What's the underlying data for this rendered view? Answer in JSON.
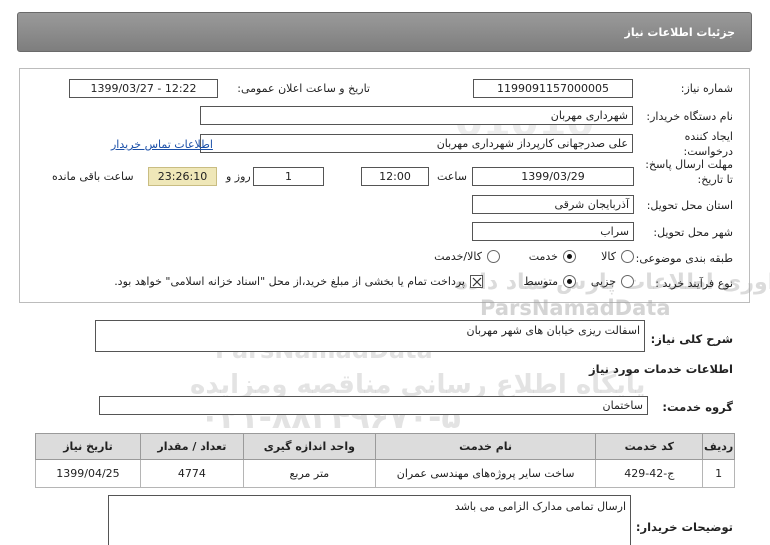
{
  "header": {
    "title": "جزئیات اطلاعات نیاز"
  },
  "form": {
    "need_number_label": "شماره نیاز:",
    "need_number": "1199091157000005",
    "announce_label": "تاریخ و ساعت اعلان عمومی:",
    "announce_value": "1399/03/27 - 12:22",
    "buyer_org_label": "نام دستگاه خریدار:",
    "buyer_org": "شهرداری مهربان",
    "creator_label": "ایجاد کننده درخواست:",
    "creator": "علی  صدرجهانی  کارپرداز شهرداری مهربان",
    "contact_link": "اطلاعات تماس خریدار",
    "deadline_label": "مهلت ارسال پاسخ: تا تاریخ:",
    "deadline_date": "1399/03/29",
    "time_label": "ساعت",
    "deadline_time": "12:00",
    "days_value": "1",
    "days_label": "روز و",
    "remaining_time": "23:26:10",
    "remaining_label": "ساعت باقی مانده",
    "province_label": "استان محل تحویل:",
    "province": "آذربایجان شرقی",
    "city_label": "شهر محل تحویل:",
    "city": "سراب",
    "category_label": "طبقه بندی موضوعی:",
    "category_options": [
      "کالا",
      "خدمت",
      "کالا/خدمت"
    ],
    "category_selected": "خدمت",
    "process_label": "نوع فرآیند خرید :",
    "process_options": [
      "جزیی",
      "متوسط"
    ],
    "process_selected": "متوسط",
    "payment_note": "پرداخت تمام یا بخشی از مبلغ خرید،از محل \"اسناد خزانه اسلامی\" خواهد بود."
  },
  "description": {
    "label": "شرح کلی نیاز:",
    "value": "اسفالت ریزی خیابان های شهر مهربان"
  },
  "services_info": {
    "title": "اطلاعات خدمات مورد نیاز",
    "group_label": "گروه خدمت:",
    "group_value": "ساختمان",
    "columns": [
      "ردیف",
      "کد خدمت",
      "نام خدمت",
      "واحد اندازه گیری",
      "تعداد / مقدار",
      "تاریخ نیاز"
    ],
    "rows": [
      [
        "1",
        "ج-42-429",
        "ساخت سایر پروژه‌های مهندسی عمران",
        "متر مربع",
        "4774",
        "1399/04/25"
      ]
    ]
  },
  "buyer_notes": {
    "label": "توضیحات خریدار:",
    "value": "ارسال تمامی مدارک الزامی می باشد"
  },
  "watermark": {
    "line1": "ParsNamadData",
    "line2": "مرکز فراوری اطلاعات پارس نماد داده",
    "line3": "پایگاه اطلاع رسانی مناقصه ومزایده",
    "line4": "۰۲۱-۸۸۳۴۹۶۷۰-۵",
    "line5": "01010"
  },
  "colors": {
    "header_bg": "#8c8c8c",
    "timer_bg": "#efe7b8",
    "link": "#1a4fa8",
    "table_header": "#dcdcdc"
  }
}
